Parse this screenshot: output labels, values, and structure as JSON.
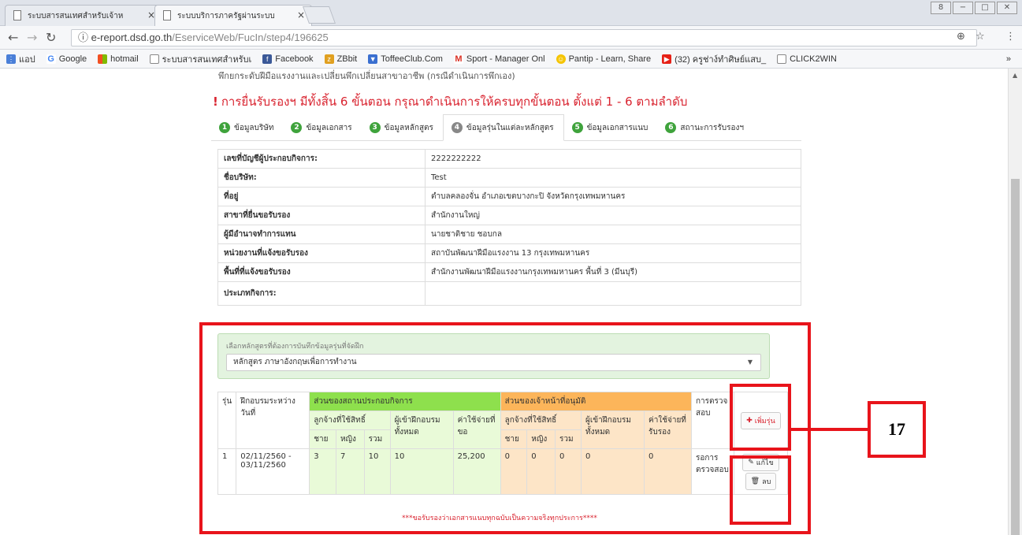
{
  "browser": {
    "tabs": [
      {
        "title": "ระบบสารสนเทศสำหรับเจ้าห",
        "close": "×"
      },
      {
        "title": "ระบบบริการภาครัฐผ่านระบบ",
        "close": "×"
      }
    ],
    "window_buttons": [
      "8",
      "−",
      "□",
      "✕"
    ],
    "url_host": "e-report.dsd.go.th",
    "url_path": "/EserviceWeb/FucIn/step4/196625",
    "bookmarks": [
      {
        "label": "แอป",
        "icon": "apps-icon"
      },
      {
        "label": "Google",
        "icon": "google-icon"
      },
      {
        "label": "hotmail",
        "icon": "windows-icon"
      },
      {
        "label": "ระบบสารสนเทศสำหรับเ",
        "icon": "page-icon"
      },
      {
        "label": "Facebook",
        "icon": "facebook-icon"
      },
      {
        "label": "ZBbit",
        "icon": "zbbit-icon"
      },
      {
        "label": "ToffeeClub.Com",
        "icon": "toffee-icon"
      },
      {
        "label": "Sport - Manager Onl",
        "icon": "gmail-icon"
      },
      {
        "label": "Pantip - Learn, Share",
        "icon": "pantip-icon"
      },
      {
        "label": "(32) ครูช่าง์ทำศิษย์แสบ_",
        "icon": "youtube-icon"
      },
      {
        "label": "CLICK2WIN",
        "icon": "page-icon"
      }
    ],
    "more": "»"
  },
  "page": {
    "cut_text": "พึกยกระดับฝีมือแรงงานและเปลี่ยนพึกเปลี่ยนสาขาอาชีพ (กรณีดำเนินการพึกเอง)",
    "heading_mark": "!",
    "heading": "การยื่นรับรองฯ มีทั้งสิ้น 6 ขั้นตอน กรุณาดำเนินการให้ครบทุกขั้นตอน ตั้งแต่ 1 - 6 ตามลำดับ",
    "steps": [
      {
        "n": "1",
        "label": "ข้อมูลบริษัท"
      },
      {
        "n": "2",
        "label": "ข้อมูลเอกสาร"
      },
      {
        "n": "3",
        "label": "ข้อมูลหลักสูตร"
      },
      {
        "n": "4",
        "label": "ข้อมูลรุ่นในแต่ละหลักสูตร"
      },
      {
        "n": "5",
        "label": "ข้อมูลเอกสารแนบ"
      },
      {
        "n": "6",
        "label": "สถานะการรับรองฯ"
      }
    ],
    "info": [
      {
        "k": "เลขที่บัญชีผู้ประกอบกิจการ:",
        "v": "2222222222"
      },
      {
        "k": "ชื่อบริษัท:",
        "v": "Test"
      },
      {
        "k": "ที่อยู่",
        "v": "ตำบลคลองจั่น อำเภอเขตบางกะปิ จังหวัดกรุงเทพมหานคร"
      },
      {
        "k": "สาขาที่ยื่นขอรับรอง",
        "v": "สำนักงานใหญ่"
      },
      {
        "k": "ผู้มีอำนาจทำการแทน",
        "v": "นายชาติชาย ชอบกล"
      },
      {
        "k": "หน่วยงานที่แจ้งขอรับรอง",
        "v": "สถาบันพัฒนาฝีมือแรงงาน 13 กรุงเทพมหานคร"
      },
      {
        "k": "พื้นที่ที่แจ้งขอรับรอง",
        "v": "สำนักงานพัฒนาฝีมือแรงงานกรุงเทพมหานคร พื้นที่ 3 (มีนบุรี)"
      },
      {
        "k": "ประเภทกิจการ:",
        "v": ""
      }
    ],
    "select_label": "เลือกหลักสูตรที่ต้องการบันทึกข้อมูลรุ่นที่จัดฝึก",
    "select_value": "หลักสูตร ภาษาอังกฤษเพื่อการทำงาน",
    "table": {
      "h_run": "รุ่น",
      "h_dates": "ฝึกอบรมระหว่างวันที่",
      "h_company": "ส่วนของสถานประกอบกิจการ",
      "h_officer": "ส่วนของเจ้าหน้าที่อนุมัติ",
      "h_inspect": "การตรวจสอบ",
      "h_employees": "ลูกจ้างที่ใช้สิทธิ์",
      "h_trainees": "ผู้เข้าฝึกอบรมทั้งหมด",
      "h_cost_req": "ค่าใช้จ่ายที่ขอ",
      "h_trainees2": "ผู้เข้าฝึกอบรมทั้งหมด",
      "h_cost_app": "ค่าใช้จ่ายที่รับรอง",
      "h_male": "ชาย",
      "h_female": "หญิง",
      "h_total": "รวม",
      "add_button": "เพิ่มรุ่น",
      "edit_button": "แก้ไข",
      "delete_button": "ลบ",
      "row": {
        "run": "1",
        "dates": "02/11/2560 - 03/11/2560",
        "male": "3",
        "female": "7",
        "total": "10",
        "trainees": "10",
        "cost": "25,200",
        "o_male": "0",
        "o_female": "0",
        "o_total": "0",
        "o_trainees": "0",
        "o_cost": "0",
        "status": "รอการตรวจสอบ"
      }
    },
    "note": "***ขอรับรองว่าเอกสารแนบทุกฉบับเป็นความจริงทุกประการ****"
  },
  "callout": {
    "number": "17"
  },
  "colors": {
    "red": "#e8141b",
    "green_head": "#8ee04d",
    "orange_head": "#fcb55a"
  }
}
